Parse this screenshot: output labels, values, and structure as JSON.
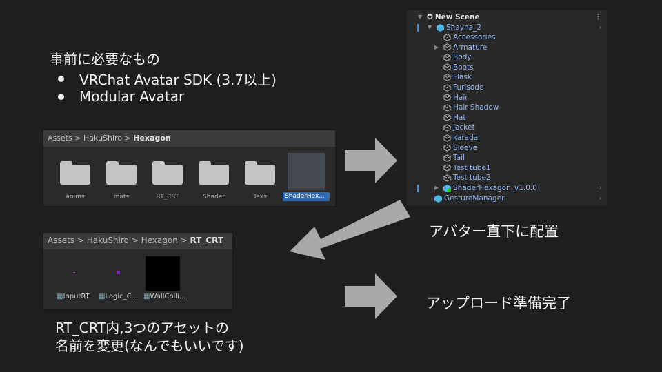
{
  "requirements": {
    "title": "事前に必要なもの",
    "items": [
      "VRChat Avatar SDK (3.7以上)",
      "Modular Avatar"
    ]
  },
  "project_panel": {
    "breadcrumb": [
      "Assets",
      "HakuShiro",
      "Hexagon"
    ],
    "folders": [
      "anims",
      "mats",
      "RT_CRT",
      "Shader",
      "Texs"
    ],
    "selected_asset": "ShaderHex..."
  },
  "hierarchy": {
    "scene": "New Scene",
    "root": "Shayna_2",
    "children": [
      "Accessories",
      "Armature",
      "Body",
      "Boots",
      "Flask",
      "Furisode",
      "Hair",
      "Hair Shadow",
      "Hat",
      "Jacket",
      "karada",
      "Sleeve",
      "Tail",
      "Test tube1",
      "Test tube2",
      "ShaderHexagon_v1.0.0"
    ],
    "sibling": "GestureManager"
  },
  "rt_panel": {
    "breadcrumb": [
      "Assets",
      "HakuShiro",
      "Hexagon",
      "RT_CRT"
    ],
    "assets": [
      "InputRT",
      "Logic_C...",
      "WallColli..."
    ]
  },
  "captions": {
    "place": "アバター直下に配置",
    "ready": "アップロード準備完了",
    "rename_line1": "RT_CRT内,3つのアセットの",
    "rename_line2": "名前を変更(なんでもいいです)"
  },
  "colors": {
    "arrow": "#a9a9a9",
    "link": "#8fb4f0",
    "select": "#2d6ab3"
  }
}
